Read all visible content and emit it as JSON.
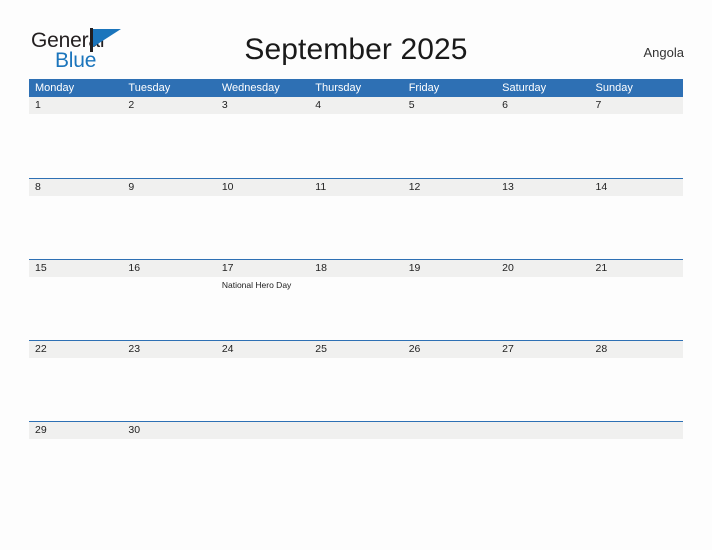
{
  "brand": {
    "line1": "General",
    "line2": "Blue",
    "flag_icon": "flag-triangle-icon",
    "accent_color": "#1b75bc",
    "text_color": "#231f20"
  },
  "header": {
    "title": "September 2025",
    "country": "Angola"
  },
  "calendar": {
    "header_color": "#2e70b4",
    "band_color": "#f0f0ef",
    "weekdays": [
      "Monday",
      "Tuesday",
      "Wednesday",
      "Thursday",
      "Friday",
      "Saturday",
      "Sunday"
    ],
    "weeks": [
      [
        {
          "day": "1",
          "events": []
        },
        {
          "day": "2",
          "events": []
        },
        {
          "day": "3",
          "events": []
        },
        {
          "day": "4",
          "events": []
        },
        {
          "day": "5",
          "events": []
        },
        {
          "day": "6",
          "events": []
        },
        {
          "day": "7",
          "events": []
        }
      ],
      [
        {
          "day": "8",
          "events": []
        },
        {
          "day": "9",
          "events": []
        },
        {
          "day": "10",
          "events": []
        },
        {
          "day": "11",
          "events": []
        },
        {
          "day": "12",
          "events": []
        },
        {
          "day": "13",
          "events": []
        },
        {
          "day": "14",
          "events": []
        }
      ],
      [
        {
          "day": "15",
          "events": []
        },
        {
          "day": "16",
          "events": []
        },
        {
          "day": "17",
          "events": [
            "National Hero Day"
          ]
        },
        {
          "day": "18",
          "events": []
        },
        {
          "day": "19",
          "events": []
        },
        {
          "day": "20",
          "events": []
        },
        {
          "day": "21",
          "events": []
        }
      ],
      [
        {
          "day": "22",
          "events": []
        },
        {
          "day": "23",
          "events": []
        },
        {
          "day": "24",
          "events": []
        },
        {
          "day": "25",
          "events": []
        },
        {
          "day": "26",
          "events": []
        },
        {
          "day": "27",
          "events": []
        },
        {
          "day": "28",
          "events": []
        }
      ],
      [
        {
          "day": "29",
          "events": []
        },
        {
          "day": "30",
          "events": []
        },
        {
          "day": "",
          "events": []
        },
        {
          "day": "",
          "events": []
        },
        {
          "day": "",
          "events": []
        },
        {
          "day": "",
          "events": []
        },
        {
          "day": "",
          "events": []
        }
      ]
    ]
  }
}
